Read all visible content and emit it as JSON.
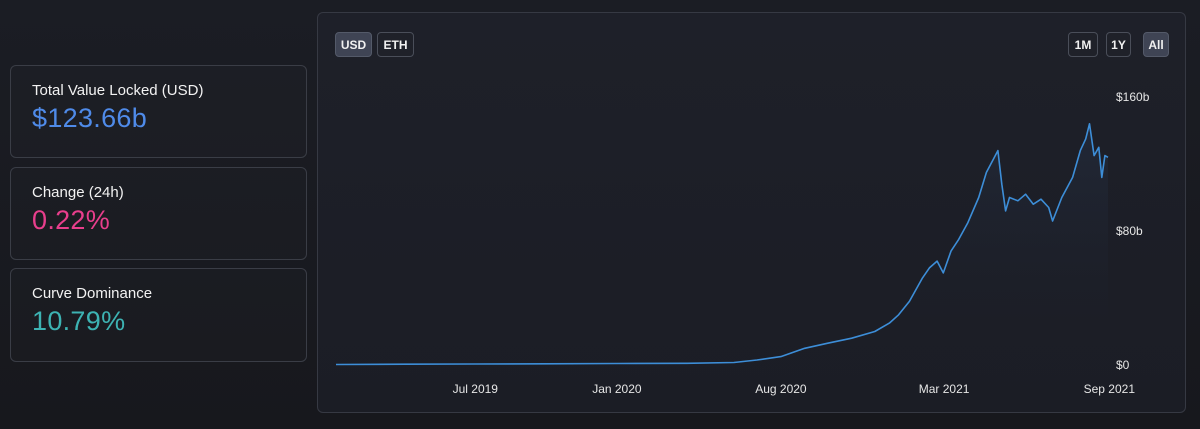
{
  "stats": {
    "tvl": {
      "label": "Total Value Locked (USD)",
      "value": "$123.66b",
      "color": "#4f8be9"
    },
    "change": {
      "label": "Change (24h)",
      "value": "0.22%",
      "color": "#e83e8c"
    },
    "dominance": {
      "label": "Curve Dominance",
      "value": "10.79%",
      "color": "#3db3b3"
    }
  },
  "controls": {
    "currency": [
      "USD",
      "ETH"
    ],
    "currency_selected": "USD",
    "ranges": [
      "1M",
      "1Y",
      "All"
    ],
    "range_selected": "All"
  },
  "chart_data": {
    "type": "line",
    "line_color": "#3d8ed8",
    "x_ticks": [
      {
        "label": "Jul 2019",
        "date": "2019-07-01"
      },
      {
        "label": "Jan 2020",
        "date": "2020-01-01"
      },
      {
        "label": "Aug 2020",
        "date": "2020-08-01"
      },
      {
        "label": "Mar 2021",
        "date": "2021-03-01"
      },
      {
        "label": "Sep 2021",
        "date": "2021-09-01"
      }
    ],
    "y_ticks": [
      {
        "label": "$160b",
        "value": 160
      },
      {
        "label": "$80b",
        "value": 80
      },
      {
        "label": "$0",
        "value": 0
      }
    ],
    "ylim": [
      0,
      160
    ],
    "y_unit": "billion USD",
    "grid": false,
    "series": [
      {
        "points": [
          [
            "2019-01-01",
            0.3
          ],
          [
            "2019-04-01",
            0.5
          ],
          [
            "2019-07-01",
            0.6
          ],
          [
            "2019-10-01",
            0.7
          ],
          [
            "2020-01-01",
            0.9
          ],
          [
            "2020-04-01",
            1.0
          ],
          [
            "2020-06-01",
            1.5
          ],
          [
            "2020-07-01",
            3
          ],
          [
            "2020-08-01",
            5
          ],
          [
            "2020-09-01",
            10
          ],
          [
            "2020-10-01",
            13
          ],
          [
            "2020-11-01",
            16
          ],
          [
            "2020-12-01",
            20
          ],
          [
            "2020-12-20",
            25
          ],
          [
            "2021-01-01",
            30
          ],
          [
            "2021-01-15",
            38
          ],
          [
            "2021-02-01",
            52
          ],
          [
            "2021-02-10",
            58
          ],
          [
            "2021-02-20",
            62
          ],
          [
            "2021-02-28",
            55
          ],
          [
            "2021-03-10",
            68
          ],
          [
            "2021-03-20",
            75
          ],
          [
            "2021-04-01",
            85
          ],
          [
            "2021-04-15",
            100
          ],
          [
            "2021-04-25",
            115
          ],
          [
            "2021-05-10",
            128
          ],
          [
            "2021-05-15",
            108
          ],
          [
            "2021-05-20",
            92
          ],
          [
            "2021-05-25",
            100
          ],
          [
            "2021-06-05",
            98
          ],
          [
            "2021-06-15",
            102
          ],
          [
            "2021-06-25",
            96
          ],
          [
            "2021-07-05",
            99
          ],
          [
            "2021-07-15",
            94
          ],
          [
            "2021-07-20",
            86
          ],
          [
            "2021-08-01",
            100
          ],
          [
            "2021-08-15",
            112
          ],
          [
            "2021-08-25",
            128
          ],
          [
            "2021-09-01",
            135
          ],
          [
            "2021-09-06",
            144
          ],
          [
            "2021-09-12",
            125
          ],
          [
            "2021-09-18",
            130
          ],
          [
            "2021-09-22",
            112
          ],
          [
            "2021-09-26",
            125
          ],
          [
            "2021-09-30",
            124
          ]
        ]
      }
    ]
  }
}
